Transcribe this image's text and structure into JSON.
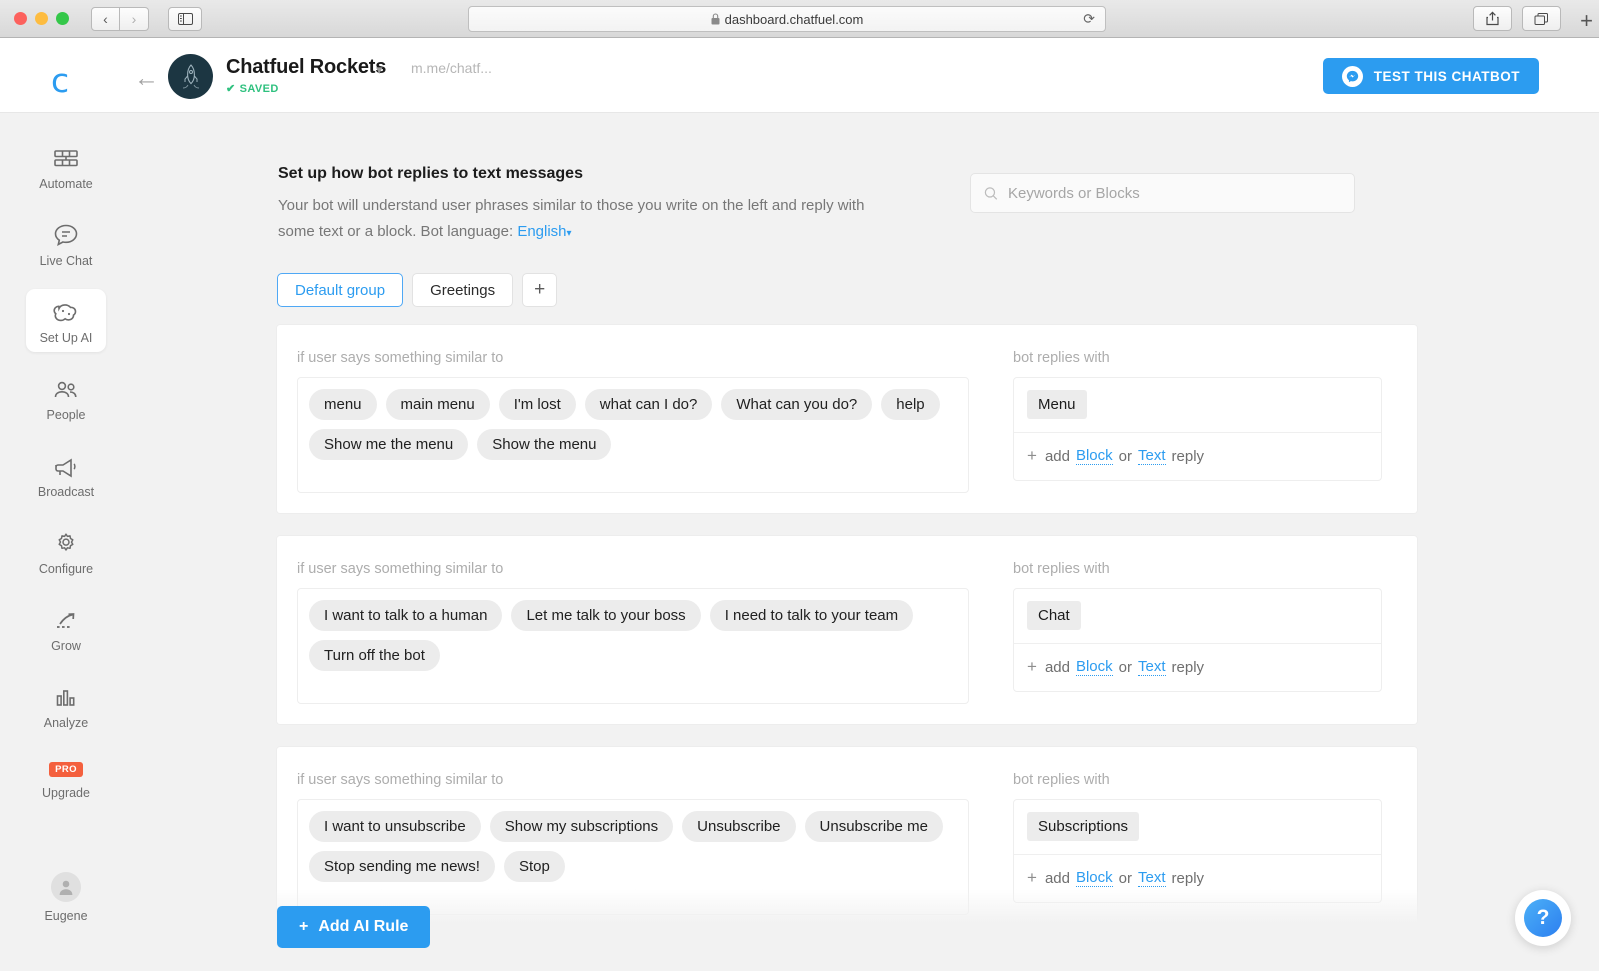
{
  "browser": {
    "url": "dashboard.chatfuel.com",
    "lock_icon": "lock-icon",
    "back_glyph": "‹",
    "forward_glyph": "›",
    "reload_glyph": "⟳",
    "share_glyph": "⇪",
    "tabs_glyph": "❐",
    "new_tab_glyph": "+"
  },
  "header": {
    "logo": "chatfuel-logo",
    "back_glyph": "←",
    "bot_name": "Chatfuel Rockets",
    "status": "SAVED",
    "status_check": "✔",
    "caret": "▾",
    "bot_url": "m.me/chatf...",
    "test_button": "TEST THIS CHATBOT"
  },
  "sidebar": {
    "items": [
      {
        "label": "Automate",
        "icon": "automate-icon",
        "active": false
      },
      {
        "label": "Live Chat",
        "icon": "live-chat-icon",
        "active": false
      },
      {
        "label": "Set Up AI",
        "icon": "set-up-ai-icon",
        "active": true
      },
      {
        "label": "People",
        "icon": "people-icon",
        "active": false
      },
      {
        "label": "Broadcast",
        "icon": "broadcast-icon",
        "active": false
      },
      {
        "label": "Configure",
        "icon": "configure-icon",
        "active": false
      },
      {
        "label": "Grow",
        "icon": "grow-icon",
        "active": false
      },
      {
        "label": "Analyze",
        "icon": "analyze-icon",
        "active": false
      },
      {
        "label": "Upgrade",
        "icon": "upgrade-icon",
        "active": false,
        "badge": "PRO"
      }
    ],
    "user": {
      "name": "Eugene",
      "avatar": "user-avatar-icon"
    }
  },
  "main": {
    "title": "Set up how bot replies to text messages",
    "subtitle_part1": "Your bot will understand user phrases similar to those you write on the left and reply with some text or a block. Bot language:",
    "language": "English",
    "language_caret": "▾",
    "search": {
      "placeholder": "Keywords or Blocks",
      "value": "",
      "icon": "search-icon"
    },
    "group_tabs": [
      {
        "label": "Default group",
        "active": true
      },
      {
        "label": "Greetings",
        "active": false
      }
    ],
    "add_group_glyph": "+",
    "left_column_header": "if user says something similar to",
    "right_column_header": "bot replies with",
    "add_reply": {
      "plus": "+",
      "add": "add",
      "block": "Block",
      "or": "or",
      "text": "Text",
      "reply": "reply"
    },
    "rules": [
      {
        "phrases": [
          "menu",
          "main menu",
          "I'm lost",
          "what can I do?",
          "What can you do?",
          "help",
          "Show me the menu",
          "Show the menu"
        ],
        "reply_block": "Menu"
      },
      {
        "phrases": [
          "I want to talk to a human",
          "Let me talk to your boss",
          "I need to talk to your team",
          "Turn off the bot"
        ],
        "reply_block": "Chat"
      },
      {
        "phrases": [
          "I want to unsubscribe",
          "Show my subscriptions",
          "Unsubscribe",
          "Unsubscribe me",
          "Stop sending me news!",
          "Stop"
        ],
        "reply_block": "Subscriptions"
      }
    ],
    "add_rule_button": {
      "plus": "+",
      "label": "Add AI Rule"
    },
    "help_button": "?"
  },
  "colors": {
    "accent": "#2c9cf0",
    "saved_green": "#2fc17f",
    "pro_badge": "#f4603e",
    "chip_bg": "#ececec"
  }
}
